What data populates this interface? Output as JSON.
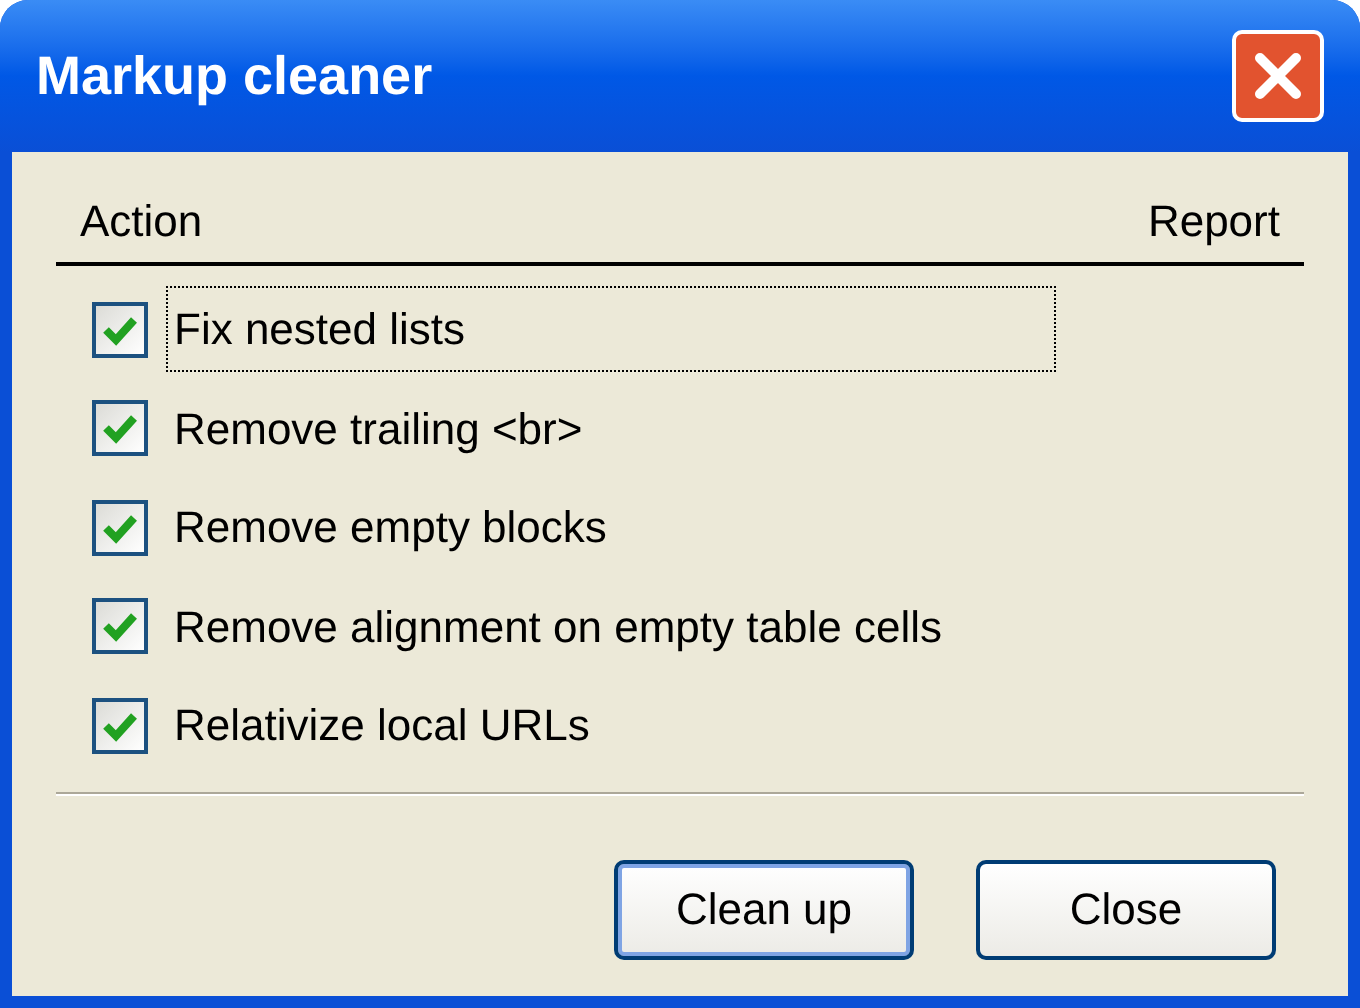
{
  "window": {
    "title": "Markup cleaner"
  },
  "columns": [
    "Action",
    "Report"
  ],
  "items": [
    {
      "label": "Fix nested lists",
      "checked": true,
      "focused": true
    },
    {
      "label": "Remove trailing <br>",
      "checked": true,
      "focused": false
    },
    {
      "label": "Remove empty blocks",
      "checked": true,
      "focused": false
    },
    {
      "label": "Remove alignment on empty table cells",
      "checked": true,
      "focused": false
    },
    {
      "label": "Relativize local URLs",
      "checked": true,
      "focused": false
    }
  ],
  "buttons": [
    {
      "label": "Clean up",
      "default": true
    },
    {
      "label": "Close",
      "default": false
    }
  ]
}
